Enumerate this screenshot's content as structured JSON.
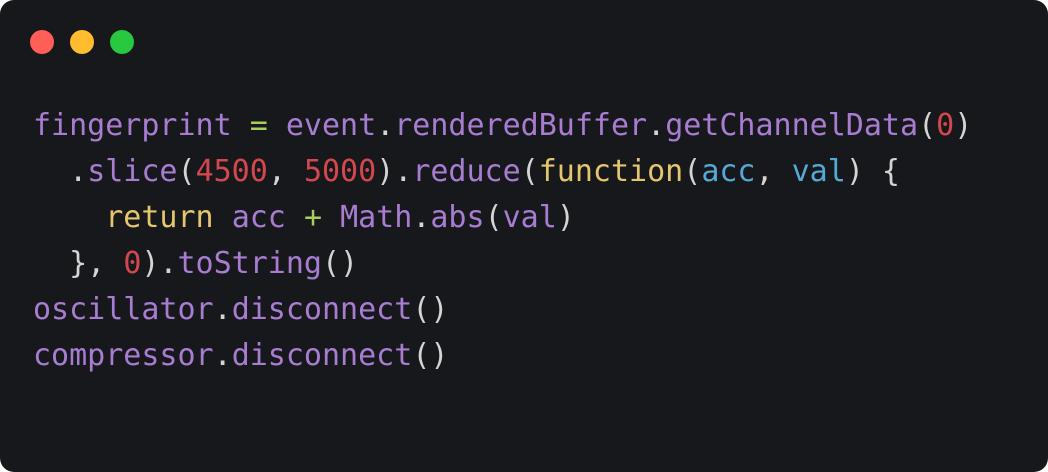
{
  "window": {
    "controls": [
      {
        "name": "close",
        "color": "#ff5f57"
      },
      {
        "name": "minimize",
        "color": "#febc2e"
      },
      {
        "name": "zoom",
        "color": "#28c840"
      }
    ]
  },
  "theme": {
    "background": "#17181b",
    "plain": "#d4d4d4",
    "identifier": "#a87dd1",
    "operator": "#a6cf5c",
    "number": "#d2484e",
    "keyword": "#e4c66e",
    "param": "#56a9d6"
  },
  "code": {
    "lines": [
      [
        {
          "text": "fingerprint",
          "kind": "identifier"
        },
        {
          "text": " ",
          "kind": "plain"
        },
        {
          "text": "=",
          "kind": "operator"
        },
        {
          "text": " ",
          "kind": "plain"
        },
        {
          "text": "event",
          "kind": "identifier"
        },
        {
          "text": ".",
          "kind": "plain"
        },
        {
          "text": "renderedBuffer",
          "kind": "identifier"
        },
        {
          "text": ".",
          "kind": "plain"
        },
        {
          "text": "getChannelData",
          "kind": "identifier"
        },
        {
          "text": "(",
          "kind": "plain"
        },
        {
          "text": "0",
          "kind": "number"
        },
        {
          "text": ")",
          "kind": "plain"
        }
      ],
      [
        {
          "text": "  .",
          "kind": "plain"
        },
        {
          "text": "slice",
          "kind": "identifier"
        },
        {
          "text": "(",
          "kind": "plain"
        },
        {
          "text": "4500",
          "kind": "number"
        },
        {
          "text": ", ",
          "kind": "plain"
        },
        {
          "text": "5000",
          "kind": "number"
        },
        {
          "text": ").",
          "kind": "plain"
        },
        {
          "text": "reduce",
          "kind": "identifier"
        },
        {
          "text": "(",
          "kind": "plain"
        },
        {
          "text": "function",
          "kind": "keyword"
        },
        {
          "text": "(",
          "kind": "plain"
        },
        {
          "text": "acc",
          "kind": "param"
        },
        {
          "text": ", ",
          "kind": "plain"
        },
        {
          "text": "val",
          "kind": "param"
        },
        {
          "text": ") {",
          "kind": "plain"
        }
      ],
      [
        {
          "text": "    ",
          "kind": "plain"
        },
        {
          "text": "return",
          "kind": "keyword"
        },
        {
          "text": " ",
          "kind": "plain"
        },
        {
          "text": "acc",
          "kind": "identifier"
        },
        {
          "text": " ",
          "kind": "plain"
        },
        {
          "text": "+",
          "kind": "operator"
        },
        {
          "text": " ",
          "kind": "plain"
        },
        {
          "text": "Math",
          "kind": "identifier"
        },
        {
          "text": ".",
          "kind": "plain"
        },
        {
          "text": "abs",
          "kind": "identifier"
        },
        {
          "text": "(",
          "kind": "plain"
        },
        {
          "text": "val",
          "kind": "identifier"
        },
        {
          "text": ")",
          "kind": "plain"
        }
      ],
      [
        {
          "text": "  }, ",
          "kind": "plain"
        },
        {
          "text": "0",
          "kind": "number"
        },
        {
          "text": ").",
          "kind": "plain"
        },
        {
          "text": "toString",
          "kind": "identifier"
        },
        {
          "text": "()",
          "kind": "plain"
        }
      ],
      [
        {
          "text": "oscillator",
          "kind": "identifier"
        },
        {
          "text": ".",
          "kind": "plain"
        },
        {
          "text": "disconnect",
          "kind": "identifier"
        },
        {
          "text": "()",
          "kind": "plain"
        }
      ],
      [
        {
          "text": "compressor",
          "kind": "identifier"
        },
        {
          "text": ".",
          "kind": "plain"
        },
        {
          "text": "disconnect",
          "kind": "identifier"
        },
        {
          "text": "()",
          "kind": "plain"
        }
      ]
    ]
  }
}
